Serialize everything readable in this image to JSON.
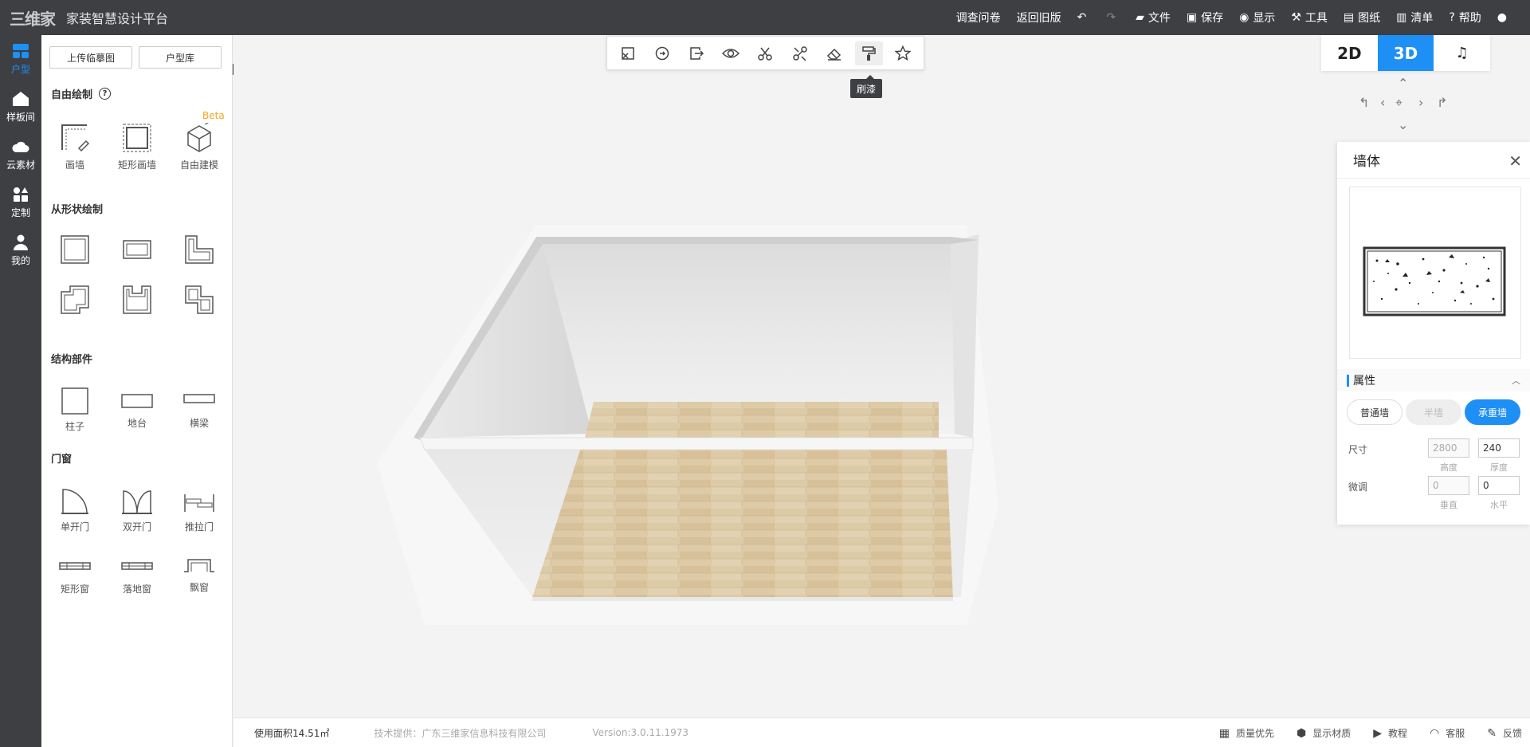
{
  "topbar": {
    "logo_text": "三维家",
    "app_title": "家装智慧设计平台",
    "menu": [
      {
        "label": "调查问卷",
        "icon": ""
      },
      {
        "label": "返回旧版",
        "icon": ""
      },
      {
        "label": "",
        "icon": "undo-icon"
      },
      {
        "label": "",
        "icon": "redo-icon"
      },
      {
        "label": "文件",
        "icon": "folder-icon"
      },
      {
        "label": "保存",
        "icon": "save-icon"
      },
      {
        "label": "显示",
        "icon": "eye-icon"
      },
      {
        "label": "工具",
        "icon": "wrench-icon"
      },
      {
        "label": "图纸",
        "icon": "map-icon"
      },
      {
        "label": "清单",
        "icon": "list-icon"
      },
      {
        "label": "帮助",
        "icon": "help-icon"
      },
      {
        "label": "",
        "icon": "user-icon"
      }
    ]
  },
  "rail": {
    "items": [
      {
        "label": "户型",
        "icon": "floorplan-icon",
        "active": true
      },
      {
        "label": "样板间",
        "icon": "house-icon",
        "active": false
      },
      {
        "label": "云素材",
        "icon": "cloud-icon",
        "active": false
      },
      {
        "label": "定制",
        "icon": "apps-icon",
        "active": false
      },
      {
        "label": "我的",
        "icon": "person-icon",
        "active": false
      }
    ]
  },
  "leftpanel": {
    "upload_label": "上传临摹图",
    "library_label": "户型库",
    "sections": {
      "free_draw": "自由绘制",
      "shape_draw": "从形状绘制",
      "structure": "结构部件",
      "doors_windows": "门窗"
    },
    "beta": "Beta",
    "free_tools": [
      "画墙",
      "矩形画墙",
      "自由建模"
    ],
    "structure_tools": [
      "柱子",
      "地台",
      "横梁"
    ],
    "door_tools": [
      "单开门",
      "双开门",
      "推拉门"
    ],
    "window_tools": [
      "矩形窗",
      "落地窗",
      "飘窗"
    ]
  },
  "toolbar": {
    "tooltip": "刷漆",
    "buttons": [
      "select-icon",
      "rotate-icon",
      "export-icon",
      "eye-icon",
      "cut-icon",
      "split-icon",
      "eraser-icon",
      "paint-roller-icon",
      "star-icon"
    ]
  },
  "view": {
    "btn_2d": "2D",
    "btn_3d": "3D",
    "btn_walk": "walk-icon",
    "active": "3D"
  },
  "rightpanel": {
    "title": "墙体",
    "section": "属性",
    "wall_types": [
      "普通墙",
      "半墙",
      "承重墙"
    ],
    "active_type": "承重墙",
    "size_label": "尺寸",
    "height_value": "2800",
    "thickness_value": "240",
    "height_caption": "高度",
    "thickness_caption": "厚度",
    "adjust_label": "微调",
    "vertical_value": "0",
    "horizontal_value": "0",
    "vertical_caption": "垂直",
    "horizontal_caption": "水平"
  },
  "statusbar": {
    "area": "使用面积14.51㎡",
    "tech": "技术提供：广东三维家信息科技有限公司",
    "version": "Version:3.0.11.1973",
    "items": [
      {
        "label": "质量优先",
        "icon": "quality-icon"
      },
      {
        "label": "显示材质",
        "icon": "cube-icon"
      },
      {
        "label": "教程",
        "icon": "video-icon"
      },
      {
        "label": "客服",
        "icon": "headset-icon"
      },
      {
        "label": "反馈",
        "icon": "feedback-icon"
      }
    ]
  },
  "colors": {
    "accent": "#1e8ff5",
    "topbar": "#3d3f43",
    "beta": "#f5a623"
  }
}
